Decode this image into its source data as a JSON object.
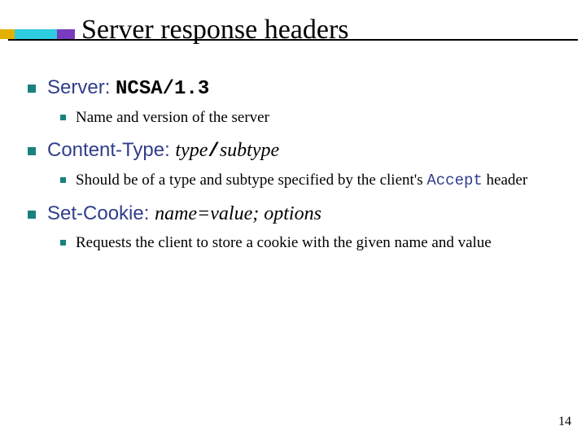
{
  "title": "Server response headers",
  "items": [
    {
      "header_parts": {
        "name": "Server:",
        "space": " ",
        "value": "NCSA/1.3"
      },
      "sub": [
        {
          "text": "Name and version of the server"
        }
      ]
    },
    {
      "header_parts": {
        "name": "Content-Type:",
        "space": " ",
        "ital1": "type",
        "slash": "/",
        "ital2": "subtype"
      },
      "sub": [
        {
          "pre": "Should be of a type and subtype specified by the client's ",
          "code": "Accept",
          "post": " header"
        }
      ]
    },
    {
      "header_parts": {
        "name": "Set-Cookie:",
        "space": " ",
        "ital1": "name",
        "eq": "=",
        "ital2": "value",
        "sep": "; ",
        "ital3": "options"
      },
      "sub": [
        {
          "text": "Requests the client to store a cookie with the given name and value"
        }
      ]
    }
  ],
  "page_number": "14"
}
